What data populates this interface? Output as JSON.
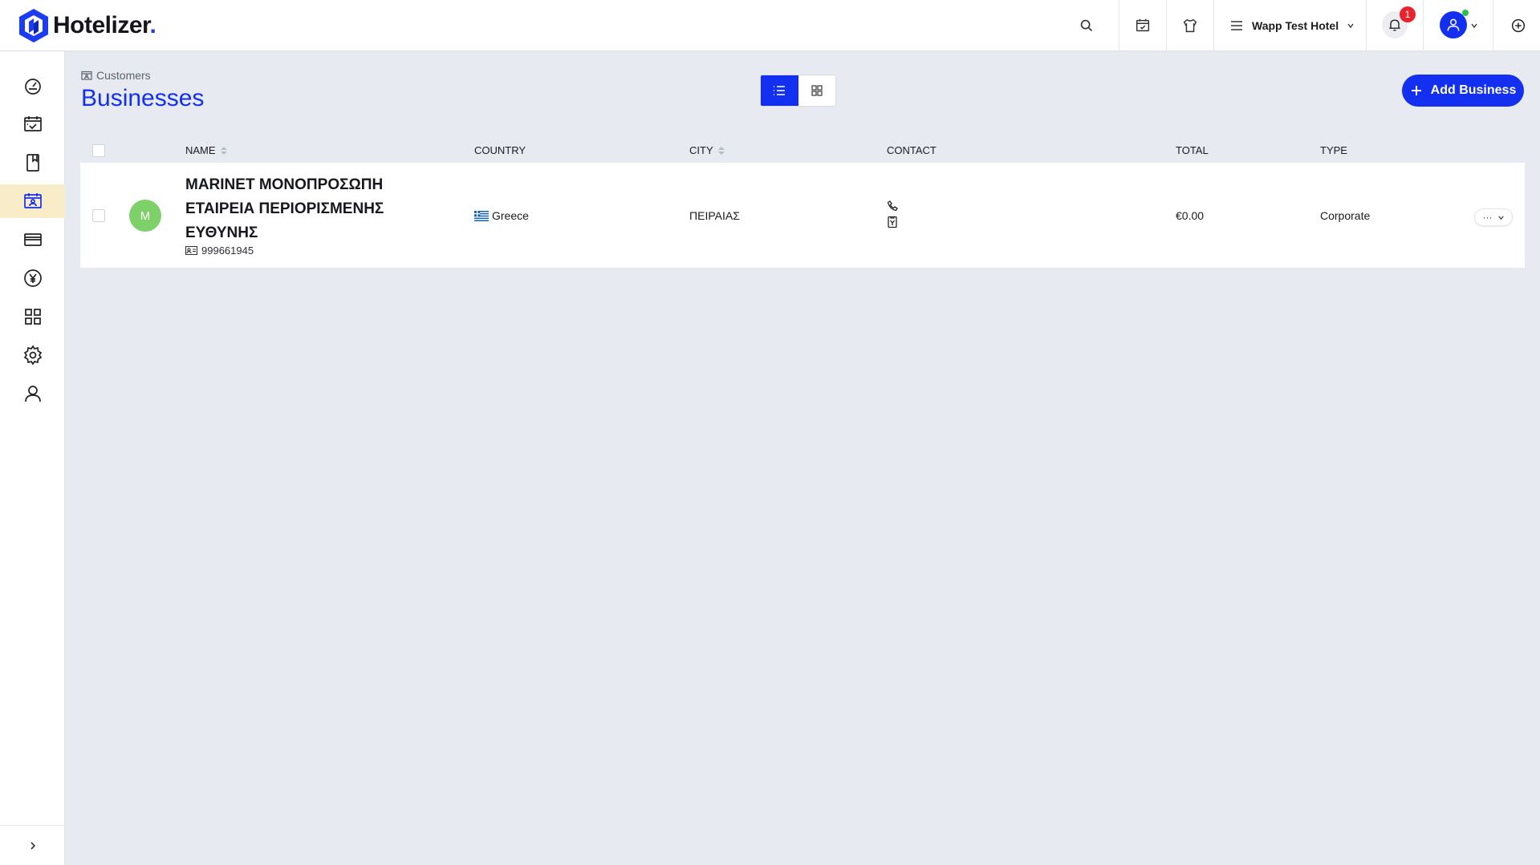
{
  "header": {
    "logo_text": "Hotelizer",
    "logo_dot": ".",
    "hotel_name": "Wapp Test Hotel",
    "notification_count": "1",
    "icons": [
      "search-icon",
      "calendar-check-icon",
      "tshirt-icon",
      "hotel-list-icon",
      "bell-icon",
      "user-icon",
      "plus-circle-icon"
    ]
  },
  "sidebar": {
    "items": [
      {
        "icon": "dashboard-icon"
      },
      {
        "icon": "calendar-check-icon"
      },
      {
        "icon": "bookmark-icon"
      },
      {
        "icon": "customers-icon",
        "active": true
      },
      {
        "icon": "card-icon"
      },
      {
        "icon": "currency-icon"
      },
      {
        "icon": "grid-icon"
      },
      {
        "icon": "settings-icon"
      },
      {
        "icon": "user-icon"
      }
    ],
    "expand_icon": "chevron-right-icon"
  },
  "page": {
    "breadcrumb": "Customers",
    "title": "Businesses",
    "add_button": "Add Business",
    "view_mode": "list"
  },
  "table": {
    "columns": {
      "name": "NAME",
      "country": "COUNTRY",
      "city": "CITY",
      "contact": "CONTACT",
      "total": "TOTAL",
      "type": "TYPE"
    },
    "rows": [
      {
        "avatar_letter": "M",
        "name": "MARINET ΜΟΝΟΠΡΟΣΩΠΗ ΕΤΑΙΡΕΙΑ ΠΕΡΙΟΡΙΣΜΕΝΗΣ ΕΥΘΥΝΗΣ",
        "vat": "999661945",
        "country": "Greece",
        "city": "ΠΕΙΡΑΙΑΣ",
        "total": "€0.00",
        "type": "Corporate",
        "more": "···"
      }
    ]
  },
  "colors": {
    "accent": "#1330f0",
    "active_nav": "#f8edc8",
    "avatar": "#7ed069",
    "badge": "#e8232d",
    "page_bg": "#e7eaf1"
  }
}
